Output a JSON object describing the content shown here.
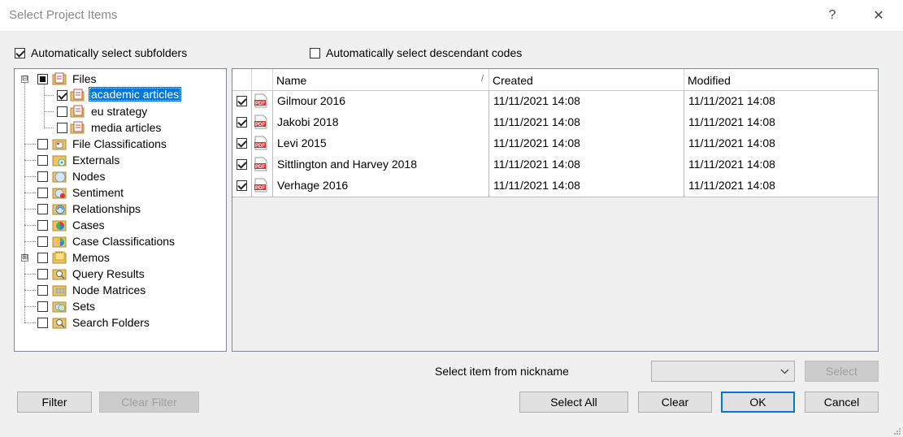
{
  "window": {
    "title": "Select Project Items",
    "help_glyph": "?",
    "close_glyph": "✕"
  },
  "options": {
    "auto_subfolders": {
      "label": "Automatically select subfolders",
      "checked": true
    },
    "auto_descendants": {
      "label": "Automatically select descendant codes",
      "checked": false
    }
  },
  "tree": {
    "root": {
      "label": "Files",
      "icon": "files-folder-icon",
      "state": "partial",
      "expander": "⊟"
    },
    "children": [
      {
        "label": "academic articles",
        "icon": "folder-doc-icon",
        "checked": true,
        "selected": true
      },
      {
        "label": "eu strategy",
        "icon": "folder-doc-icon",
        "checked": false
      },
      {
        "label": "media articles",
        "icon": "folder-doc-icon",
        "checked": false
      }
    ],
    "items": [
      {
        "label": "File Classifications",
        "icon": "file-classifications-icon"
      },
      {
        "label": "Externals",
        "icon": "externals-icon"
      },
      {
        "label": "Nodes",
        "icon": "nodes-icon"
      },
      {
        "label": "Sentiment",
        "icon": "sentiment-icon"
      },
      {
        "label": "Relationships",
        "icon": "relationships-icon"
      },
      {
        "label": "Cases",
        "icon": "cases-icon"
      },
      {
        "label": "Case Classifications",
        "icon": "case-classifications-icon"
      },
      {
        "label": "Memos",
        "icon": "memos-icon",
        "expander": "⊞"
      },
      {
        "label": "Query Results",
        "icon": "query-results-icon"
      },
      {
        "label": "Node Matrices",
        "icon": "node-matrices-icon"
      },
      {
        "label": "Sets",
        "icon": "sets-icon"
      },
      {
        "label": "Search Folders",
        "icon": "search-folders-icon"
      }
    ]
  },
  "grid": {
    "columns": [
      "Name",
      "Created",
      "Modified"
    ],
    "sort_glyph": "/",
    "rows": [
      {
        "checked": true,
        "name": "Gilmour 2016",
        "created": "11/11/2021 14:08",
        "modified": "11/11/2021 14:08"
      },
      {
        "checked": true,
        "name": "Jakobi 2018",
        "created": "11/11/2021 14:08",
        "modified": "11/11/2021 14:08"
      },
      {
        "checked": true,
        "name": "Levi 2015",
        "created": "11/11/2021 14:08",
        "modified": "11/11/2021 14:08"
      },
      {
        "checked": true,
        "name": "Sittlington and Harvey 2018",
        "created": "11/11/2021 14:08",
        "modified": "11/11/2021 14:08"
      },
      {
        "checked": true,
        "name": "Verhage 2016",
        "created": "11/11/2021 14:08",
        "modified": "11/11/2021 14:08"
      }
    ],
    "pdf_label": "PDF"
  },
  "nickname": {
    "label": "Select item from nickname",
    "value": "",
    "select_button": "Select"
  },
  "buttons": {
    "filter": "Filter",
    "clear_filter": "Clear Filter",
    "select_all": "Select All",
    "clear": "Clear",
    "ok": "OK",
    "cancel": "Cancel"
  },
  "colors": {
    "selection": "#0078d7",
    "accent_border": "#0078d7",
    "pdf_red": "#d32f2f"
  }
}
